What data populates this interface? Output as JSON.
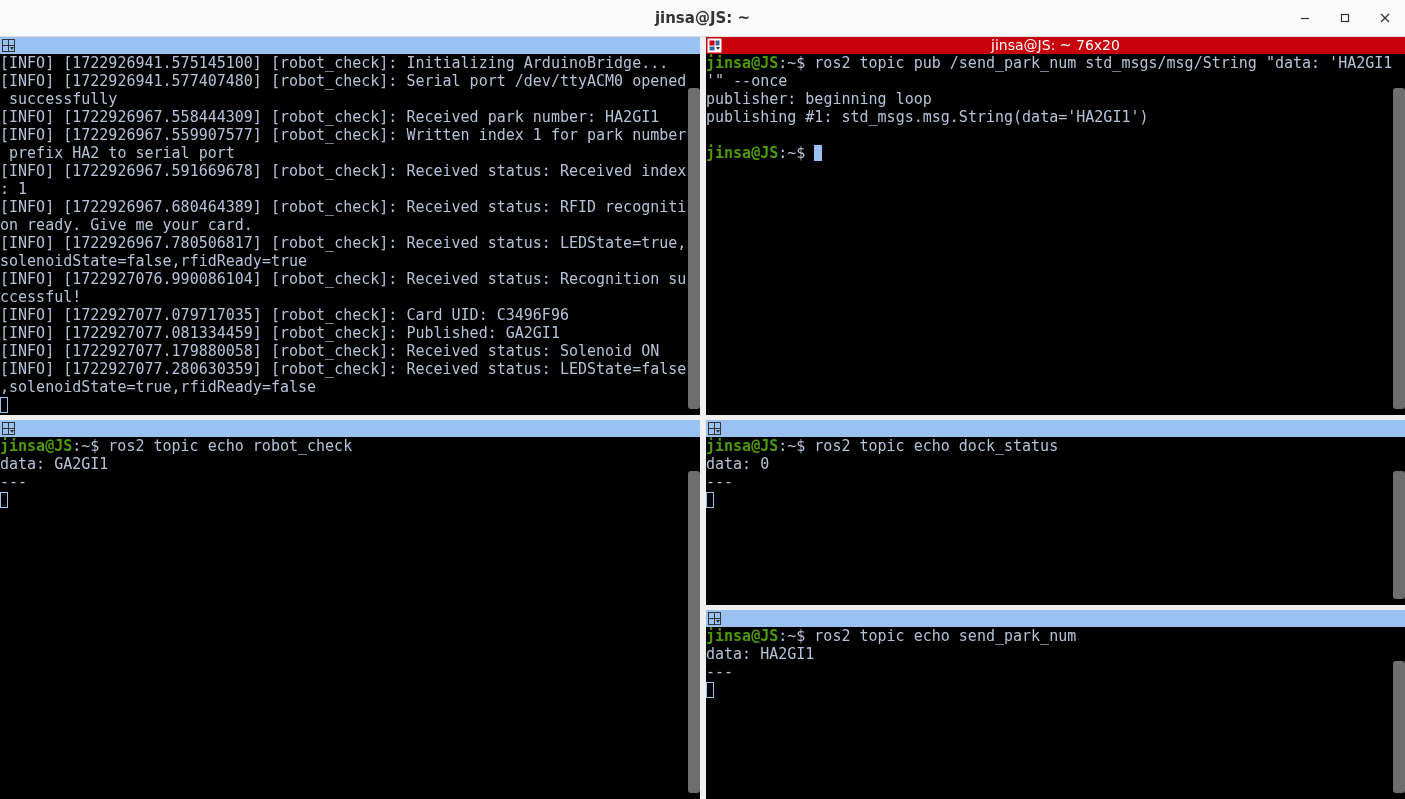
{
  "window": {
    "title": "jinsa@JS: ~"
  },
  "top_panes": [
    {
      "focused": false,
      "lines": [
        {
          "kind": "output",
          "text": "[INFO] [1722926941.575145100] [robot_check]: Initializing ArduinoBridge..."
        },
        {
          "kind": "output",
          "text": "[INFO] [1722926941.577407480] [robot_check]: Serial port /dev/ttyACM0 opened"
        },
        {
          "kind": "output",
          "text": " successfully"
        },
        {
          "kind": "output",
          "text": "[INFO] [1722926967.558444309] [robot_check]: Received park number: HA2GI1"
        },
        {
          "kind": "output",
          "text": "[INFO] [1722926967.559907577] [robot_check]: Written index 1 for park number"
        },
        {
          "kind": "output",
          "text": " prefix HA2 to serial port"
        },
        {
          "kind": "output",
          "text": "[INFO] [1722926967.591669678] [robot_check]: Received status: Received index"
        },
        {
          "kind": "output",
          "text": ": 1"
        },
        {
          "kind": "output",
          "text": "[INFO] [1722926967.680464389] [robot_check]: Received status: RFID recogniti"
        },
        {
          "kind": "output",
          "text": "on ready. Give me your card."
        },
        {
          "kind": "output",
          "text": "[INFO] [1722926967.780506817] [robot_check]: Received status: LEDState=true,"
        },
        {
          "kind": "output",
          "text": "solenoidState=false,rfidReady=true"
        },
        {
          "kind": "output",
          "text": "[INFO] [1722927076.990086104] [robot_check]: Received status: Recognition su"
        },
        {
          "kind": "output",
          "text": "ccessful!"
        },
        {
          "kind": "output",
          "text": "[INFO] [1722927077.079717035] [robot_check]: Card UID: C3496F96"
        },
        {
          "kind": "output",
          "text": "[INFO] [1722927077.081334459] [robot_check]: Published: GA2GI1"
        },
        {
          "kind": "output",
          "text": "[INFO] [1722927077.179880058] [robot_check]: Received status: Solenoid ON"
        },
        {
          "kind": "output",
          "text": "[INFO] [1722927077.280630359] [robot_check]: Received status: LEDState=false"
        },
        {
          "kind": "output",
          "text": ",solenoidState=true,rfidReady=false"
        },
        {
          "kind": "cursor"
        }
      ]
    },
    {
      "focused": true,
      "title": "jinsa@JS: ~ 76x20",
      "lines": [
        {
          "kind": "prompt",
          "user_host": "jinsa@JS",
          "path": ":~$",
          "command": "ros2 topic pub /send_park_num std_msgs/msg/String \"data: 'HA2GI1",
          "cursor": false
        },
        {
          "kind": "output",
          "text": "'\" --once"
        },
        {
          "kind": "output",
          "text": "publisher: beginning loop"
        },
        {
          "kind": "output",
          "text": "publishing #1: std_msgs.msg.String(data='HA2GI1')"
        },
        {
          "kind": "blank"
        },
        {
          "kind": "prompt",
          "user_host": "jinsa@JS",
          "path": ":~$",
          "cursor": true
        }
      ]
    }
  ],
  "bottom_left_pane": {
    "focused": false,
    "lines": [
      {
        "kind": "prompt",
        "user_host": "jinsa@JS",
        "path": ":~$",
        "command": "ros2 topic echo robot_check",
        "cursor": false
      },
      {
        "kind": "output",
        "text": "data: GA2GI1"
      },
      {
        "kind": "output",
        "text": "---"
      },
      {
        "kind": "cursor"
      }
    ]
  },
  "bottom_right_panes": [
    {
      "focused": false,
      "lines": [
        {
          "kind": "prompt",
          "user_host": "jinsa@JS",
          "path": ":~$",
          "command": "ros2 topic echo dock_status",
          "cursor": false
        },
        {
          "kind": "output",
          "text": "data: 0"
        },
        {
          "kind": "output",
          "text": "---"
        },
        {
          "kind": "cursor"
        }
      ]
    },
    {
      "focused": false,
      "lines": [
        {
          "kind": "prompt",
          "user_host": "jinsa@JS",
          "path": ":~$",
          "command": "ros2 topic echo send_park_num",
          "cursor": false
        },
        {
          "kind": "output",
          "text": "data: HA2GI1"
        },
        {
          "kind": "output",
          "text": "---"
        },
        {
          "kind": "cursor"
        }
      ]
    }
  ]
}
